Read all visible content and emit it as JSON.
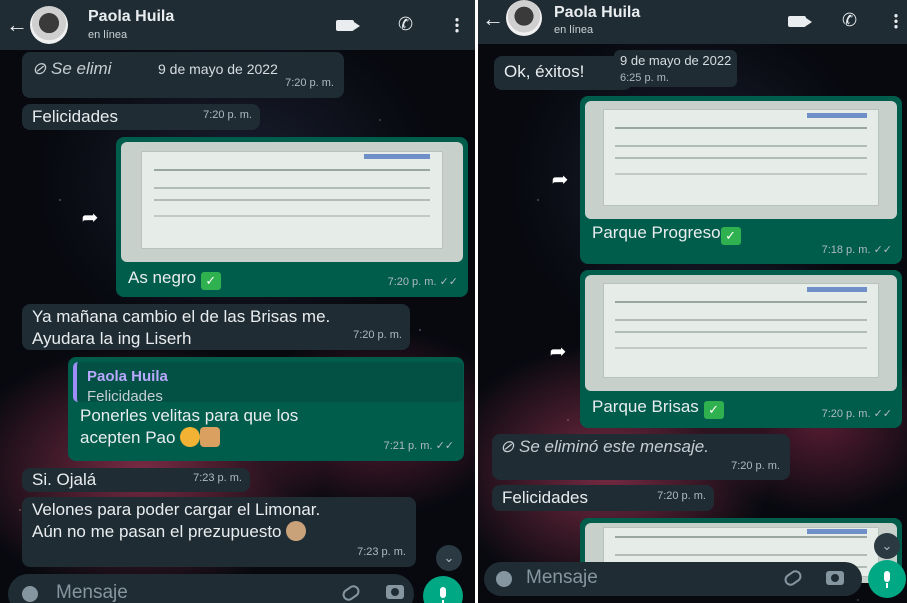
{
  "left": {
    "header": {
      "contact_name": "Paola Huila",
      "status": "en línea"
    },
    "date_chip": "9 de mayo de 2022",
    "messages": {
      "deleted": {
        "text": "Se elimi",
        "time": "7:20 p. m."
      },
      "felicidades": {
        "text": "Felicidades",
        "time": "7:20 p. m."
      },
      "photo_caption": {
        "text": "As negro",
        "time": "7:20 p. m. ✓✓"
      },
      "brisas": {
        "text": "Ya mañana cambio el de las Brisas me. Ayudara la ing Liserh",
        "time": "7:20 p. m."
      },
      "reply": {
        "quote_name": "Paola Huila",
        "quote_text": "Felicidades",
        "text": "Ponerles velitas para que los acepten Pao",
        "time": "7:21 p. m. ✓✓"
      },
      "ojala": {
        "text": "Si. Ojalá",
        "time": "7:23 p. m."
      },
      "velones": {
        "text": "Velones para poder cargar el Limonar. Aún no me pasan el prezupuesto",
        "time": "7:23 p. m."
      }
    },
    "input": {
      "placeholder": "Mensaje"
    }
  },
  "right": {
    "header": {
      "contact_name": "Paola Huila",
      "status": "en línea"
    },
    "date_chip": "9 de mayo de 2022",
    "messages": {
      "exitos": {
        "text": "Ok, éxitos!",
        "time": "6:25 p. m."
      },
      "progreso": {
        "text": "Parque Progreso",
        "time": "7:18 p. m. ✓✓"
      },
      "brisas": {
        "text": "Parque Brisas",
        "time": "7:20 p. m. ✓✓"
      },
      "deleted": {
        "text": "Se eliminó este mensaje.",
        "time": "7:20 p. m."
      },
      "felicidades": {
        "text": "Felicidades",
        "time": "7:20 p. m."
      }
    },
    "input": {
      "placeholder": "Mensaje"
    }
  },
  "colors": {
    "header_bg": "#1f2c34",
    "incoming": "#1f2c34",
    "outgoing": "#005c4b",
    "accent": "#00a884"
  }
}
